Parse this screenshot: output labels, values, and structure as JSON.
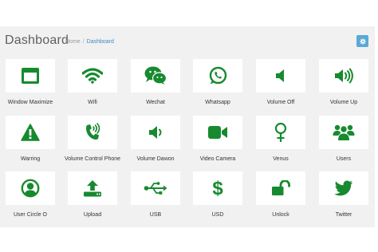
{
  "header": {
    "title": "Dashboard",
    "breadcrumb": {
      "home": "Home",
      "separator": "/",
      "current": "Dashboard"
    },
    "settings_icon": "gear-icon"
  },
  "colors": {
    "icon_green": "#178a2f",
    "panel_background": "#f1f1f1",
    "tile_background": "#ffffff",
    "accent_blue": "#3c8dbc",
    "button_blue": "#5aa8d6"
  },
  "tiles": [
    {
      "label": "Window Maximize",
      "icon": "window-maximize-icon"
    },
    {
      "label": "Wifi",
      "icon": "wifi-icon"
    },
    {
      "label": "Wechat",
      "icon": "wechat-icon"
    },
    {
      "label": "Whatsapp",
      "icon": "whatsapp-icon"
    },
    {
      "label": "Volume Off",
      "icon": "volume-off-icon"
    },
    {
      "label": "Volume Up",
      "icon": "volume-up-icon"
    },
    {
      "label": "Warring",
      "icon": "warning-icon"
    },
    {
      "label": "Volume Control Phone",
      "icon": "volume-control-phone-icon"
    },
    {
      "label": "Volume Dawon",
      "icon": "volume-down-icon"
    },
    {
      "label": "Video Camera",
      "icon": "video-camera-icon"
    },
    {
      "label": "Venus",
      "icon": "venus-icon"
    },
    {
      "label": "Users",
      "icon": "users-icon"
    },
    {
      "label": "User Circle O",
      "icon": "user-circle-icon"
    },
    {
      "label": "Upload",
      "icon": "upload-icon"
    },
    {
      "label": "USB",
      "icon": "usb-icon"
    },
    {
      "label": "USD",
      "icon": "usd-icon"
    },
    {
      "label": "Unlock",
      "icon": "unlock-icon"
    },
    {
      "label": "Twitter",
      "icon": "twitter-icon"
    }
  ]
}
